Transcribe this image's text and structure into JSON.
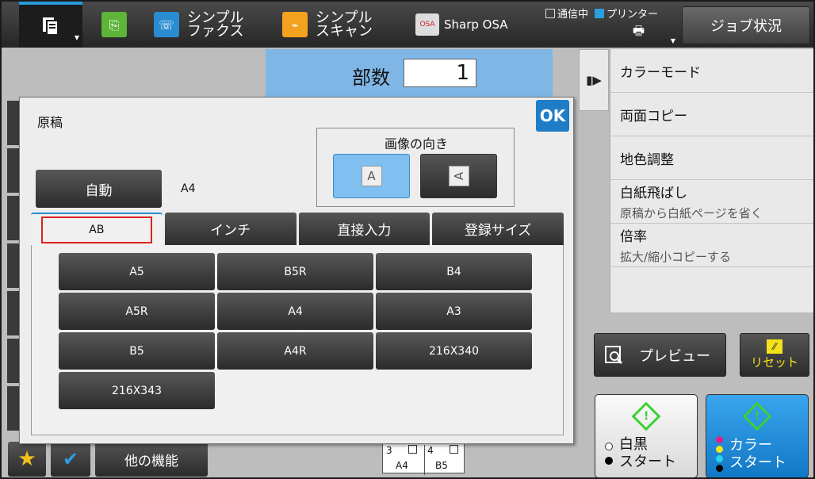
{
  "topbar": {
    "app_fax": "シンプル\nファクス",
    "app_scan": "シンプル\nスキャン",
    "app_osa": "Sharp OSA",
    "status_comm": "通信中",
    "status_printer": "プリンター",
    "job_status": "ジョブ状況"
  },
  "copies": {
    "label": "部数",
    "value": "1"
  },
  "right_panel": {
    "items": [
      {
        "label": "カラーモード",
        "sub": ""
      },
      {
        "label": "両面コピー",
        "sub": ""
      },
      {
        "label": "地色調整",
        "sub": ""
      },
      {
        "label": "白紙飛ばし",
        "sub": "原稿から白紙ページを省く"
      },
      {
        "label": "倍率",
        "sub": "拡大/縮小コピーする"
      }
    ]
  },
  "preview_label": "プレビュー",
  "reset_label": "リセット",
  "start_bw": {
    "line1": "白黒",
    "line2": "スタート"
  },
  "start_color": {
    "line1": "カラー",
    "line2": "スタート"
  },
  "bottom": {
    "other_functions": "他の機能"
  },
  "tray": {
    "t3": "3",
    "t3_size": "A4",
    "t4": "4",
    "t4_size": "B5"
  },
  "dialog": {
    "title": "原稿",
    "ok": "OK",
    "orientation_label": "画像の向き",
    "orient_glyph": "A",
    "auto_label": "自動",
    "auto_value": "A4",
    "tabs": [
      "AB",
      "インチ",
      "直接入力",
      "登録サイズ"
    ],
    "sizes": [
      "A5",
      "B5R",
      "B4",
      "A5R",
      "A4",
      "A3",
      "B5",
      "A4R",
      "216X340",
      "216X343"
    ]
  }
}
